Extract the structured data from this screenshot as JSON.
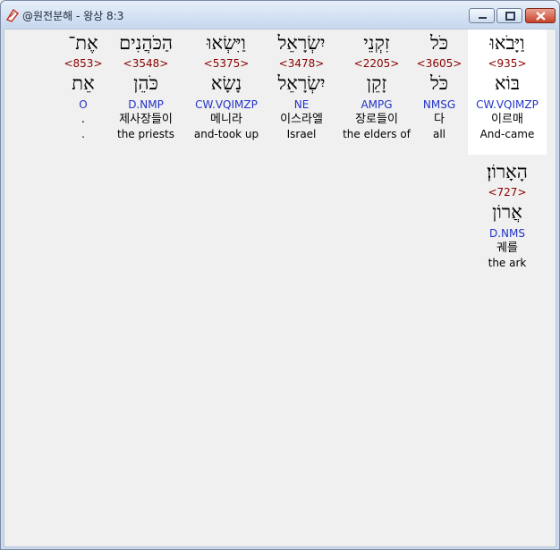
{
  "window": {
    "title": "@원전분해 - 왕상 8:3",
    "icons": {
      "app": "bible-app-icon",
      "minimize": "minimize-icon",
      "maximize": "maximize-icon",
      "close": "close-icon"
    }
  },
  "words": [
    {
      "hebrew": "וַיָּבֹאוּ",
      "strong": "<935>",
      "root": "בּוֹא",
      "parse": "CW.VQIMZP",
      "korean": "이르매",
      "english": "And-came"
    },
    {
      "hebrew": "כֹּל",
      "strong": "<3605>",
      "root": "כֹּל",
      "parse": "NMSG",
      "korean": "다",
      "english": "all"
    },
    {
      "hebrew": "זִקְנֵי",
      "strong": "<2205>",
      "root": "זָקֵן",
      "parse": "AMPG",
      "korean": "장로들이",
      "english": "the elders of"
    },
    {
      "hebrew": "יִשְׂרָאֵל",
      "strong": "<3478>",
      "root": "יִשְׂרָאֵל",
      "parse": "NE",
      "korean": "이스라엘",
      "english": "Israel"
    },
    {
      "hebrew": "וַיִּשְׂאוּ",
      "strong": "<5375>",
      "root": "נָשָׂא",
      "parse": "CW.VQIMZP",
      "korean": "메니라",
      "english": "and-took up"
    },
    {
      "hebrew": "הַכֹּהֲנִים",
      "strong": "<3548>",
      "root": "כֹּהֵן",
      "parse": "D.NMP",
      "korean": "제사장들이",
      "english": "the priests"
    },
    {
      "hebrew": "אֶת־",
      "strong": "<853>",
      "root": "אֵת",
      "parse": "O",
      "korean": ".",
      "english": "."
    },
    {
      "hebrew": "הָאָרוֹן׃",
      "strong": "<727>",
      "root": "אֲרוֹן",
      "parse": "D.NMS",
      "korean": "궤를",
      "english": "the ark"
    }
  ]
}
